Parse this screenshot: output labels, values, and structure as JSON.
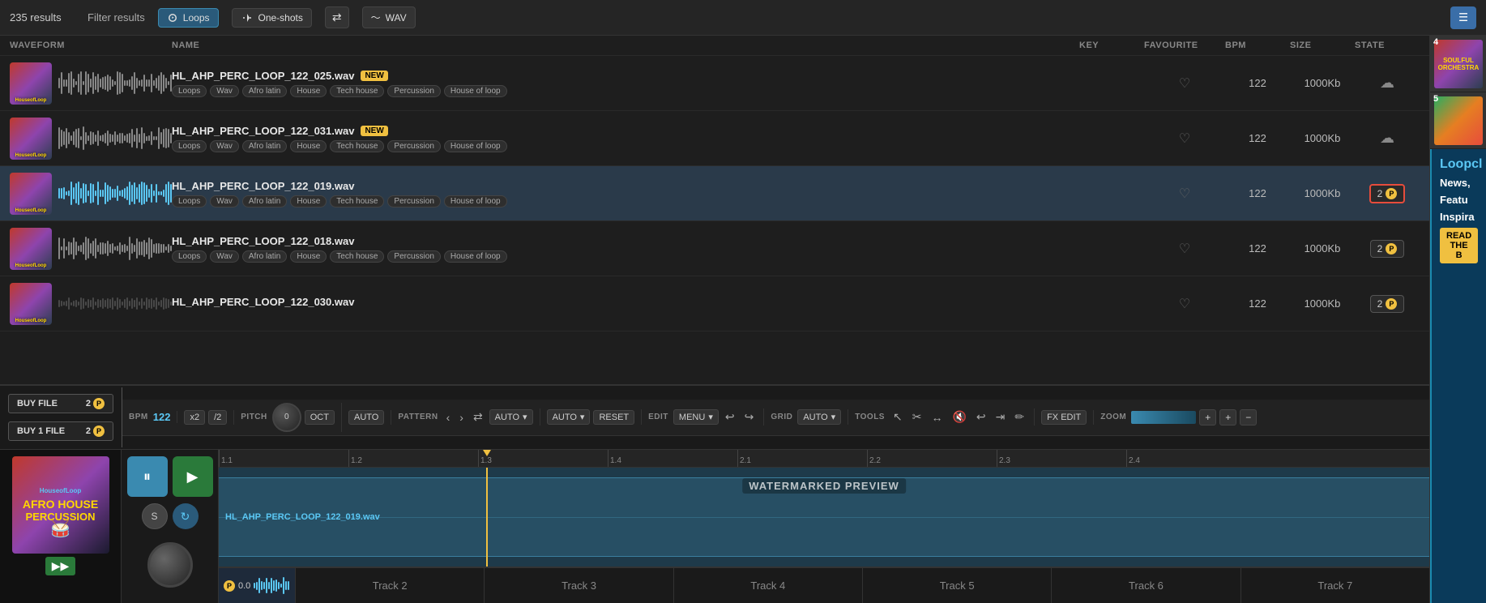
{
  "topbar": {
    "results": "235 results",
    "filter_label": "Filter results",
    "btn_loops": "Loops",
    "btn_oneshots": "One-shots",
    "btn_wav": "WAV",
    "list_view_icon": "☰"
  },
  "columns": {
    "waveform": "WAVEFORM",
    "name": "NAME",
    "key": "KEY",
    "favourite": "FAVOURITE",
    "bpm": "BPM",
    "size": "SIZE",
    "state": "STATE"
  },
  "tracks": [
    {
      "id": 1,
      "name": "HL_AHP_PERC_LOOP_122_025.wav",
      "is_new": true,
      "tags": [
        "Loops",
        "Wav",
        "Afro latin",
        "House",
        "Tech house",
        "Percussion",
        "House of loop"
      ],
      "bpm": "122",
      "size": "1000Kb",
      "state": "cloud",
      "active": false,
      "selected": false
    },
    {
      "id": 2,
      "name": "HL_AHP_PERC_LOOP_122_031.wav",
      "is_new": true,
      "tags": [
        "Loops",
        "Wav",
        "Afro latin",
        "House",
        "Tech house",
        "Percussion",
        "House of loop"
      ],
      "bpm": "122",
      "size": "1000Kb",
      "state": "cloud",
      "active": false,
      "selected": false
    },
    {
      "id": 3,
      "name": "HL_AHP_PERC_LOOP_122_019.wav",
      "is_new": false,
      "tags": [
        "Loops",
        "Wav",
        "Afro latin",
        "House",
        "Tech house",
        "Percussion",
        "House of loop"
      ],
      "bpm": "122",
      "size": "1000Kb",
      "state": "p2_red",
      "active": true,
      "selected": true
    },
    {
      "id": 4,
      "name": "HL_AHP_PERC_LOOP_122_018.wav",
      "is_new": false,
      "tags": [
        "Loops",
        "Wav",
        "Afro latin",
        "House",
        "Tech house",
        "Percussion",
        "House of loop"
      ],
      "bpm": "122",
      "size": "1000Kb",
      "state": "p2",
      "active": false,
      "selected": false
    },
    {
      "id": 5,
      "name": "HL_AHP_PERC_LOOP_122_030.wav",
      "is_new": false,
      "tags": [],
      "bpm": "122",
      "size": "1000Kb",
      "state": "p2",
      "active": false,
      "selected": false,
      "partial": true
    }
  ],
  "transport": {
    "bpm_label": "BPM",
    "bpm_value": "122",
    "pitch_label": "PITCH",
    "pitch_knob": "0",
    "oct_label": "OCT",
    "x2_label": "x2",
    "div2_label": "/2",
    "auto_label": "AUTO",
    "pattern_label": "PATTERN",
    "edit_label": "EDIT",
    "grid_label": "GRID",
    "tools_label": "TOOLS",
    "fx_edit_label": "FX EDIT",
    "zoom_label": "ZOOM",
    "menu_label": "MENU",
    "auto_grid_label": "AUTO",
    "reset_label": "RESET"
  },
  "buy_btns": [
    {
      "label": "BUY FILE",
      "count": "2"
    },
    {
      "label": "BUY 1 FILE",
      "count": "2"
    }
  ],
  "daw": {
    "album_title_line1": "AFRO HOUSE",
    "album_title_line2": "PERCUSSION",
    "album_brand": "HouseofLoop",
    "playing_file": "HL_AHP_PERC_LOOP_122_019.wav",
    "watermark_text": "WATERMARKED PREVIEW",
    "position": "0.0"
  },
  "tracks_bottom": [
    {
      "label": "0.0",
      "type": "p"
    },
    {
      "label": "Track 2"
    },
    {
      "label": "Track 3"
    },
    {
      "label": "Track 4"
    },
    {
      "label": "Track 5"
    },
    {
      "label": "Track 6"
    },
    {
      "label": "Track 7"
    }
  ],
  "sidebar_right": {
    "items": [
      {
        "num": "4",
        "color1": "#c0392b",
        "color2": "#8e44ad"
      },
      {
        "num": "5",
        "color1": "#27ae60",
        "color2": "#e67e22"
      }
    ],
    "ad_title": "Loopcl",
    "ad_lines": [
      "News,",
      "Featu",
      "Inspira"
    ],
    "ad_read": "READ THE B"
  },
  "ruler_ticks": [
    {
      "pos": 0,
      "label": "1.1"
    },
    {
      "pos": 160,
      "label": "1.2"
    },
    {
      "pos": 320,
      "label": "1.3"
    },
    {
      "pos": 480,
      "label": "1.4"
    },
    {
      "pos": 640,
      "label": "2.1"
    },
    {
      "pos": 800,
      "label": "2.2"
    },
    {
      "pos": 960,
      "label": "2.3"
    },
    {
      "pos": 1120,
      "label": "2.4"
    }
  ]
}
